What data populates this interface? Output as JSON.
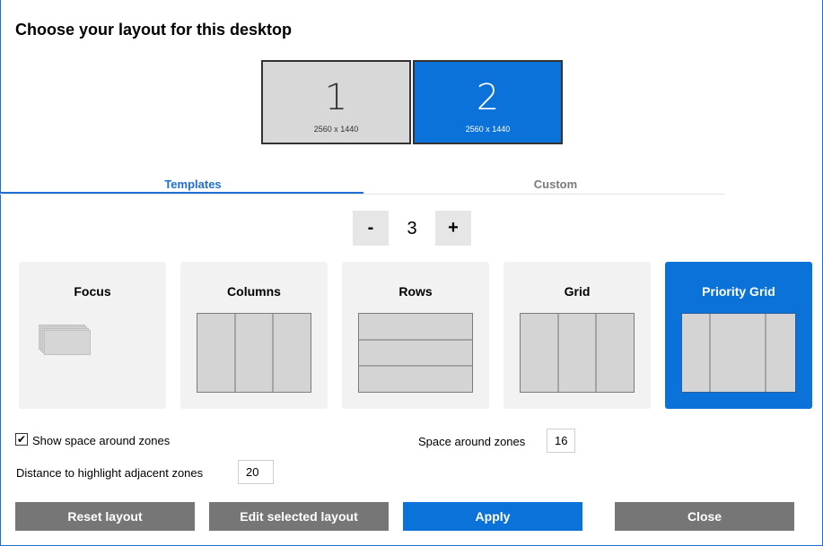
{
  "title": "Choose your layout for this desktop",
  "monitors": [
    {
      "number": "1",
      "resolution": "2560 x 1440",
      "selected": false
    },
    {
      "number": "2",
      "resolution": "2560 x 1440",
      "selected": true
    }
  ],
  "tabs": {
    "templates": "Templates",
    "custom": "Custom",
    "active": "Templates"
  },
  "zone_count": {
    "minus_label": "-",
    "value": "3",
    "plus_label": "+"
  },
  "layouts": [
    {
      "label": "Focus",
      "selected": false
    },
    {
      "label": "Columns",
      "selected": false
    },
    {
      "label": "Rows",
      "selected": false
    },
    {
      "label": "Grid",
      "selected": false
    },
    {
      "label": "Priority Grid",
      "selected": true
    }
  ],
  "settings": {
    "show_space_checked": true,
    "show_space_check_glyph": "✔",
    "show_space_label": "Show space around zones",
    "space_around_label": "Space around zones",
    "space_around_value": "16",
    "distance_label": "Distance to highlight adjacent zones",
    "distance_value": "20"
  },
  "buttons": {
    "reset": "Reset layout",
    "edit": "Edit selected layout",
    "apply": "Apply",
    "close": "Close"
  },
  "colors": {
    "accent": "#0a72d8",
    "button_gray": "#767676",
    "card_bg": "#f2f2f2"
  }
}
